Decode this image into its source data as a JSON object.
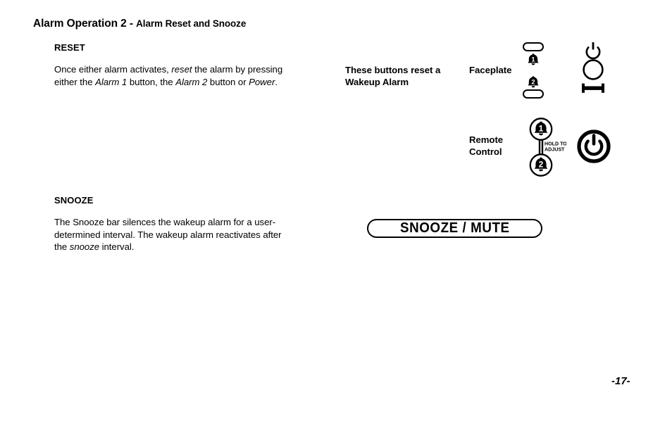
{
  "header": {
    "main": "Alarm Operation 2",
    "separator": " - ",
    "sub": "Alarm Reset and Snooze"
  },
  "sections": {
    "reset": {
      "title": "RESET",
      "body_html": "Once either alarm activates, <i>reset</i> the alarm by pressing either the <i>Alarm 1</i> button, the <i>Alarm 2</i> button or <i>Power</i>.",
      "body_text": "Once either alarm activates, reset the alarm by pressing either the Alarm 1 button, the Alarm 2 button or Power."
    },
    "snooze": {
      "title": "SNOOZE",
      "body_html": "The Snooze bar silences the wakeup alarm for a user-determined interval. The wakeup alarm reactivates after the <i>snooze</i> interval.",
      "body_text": "The Snooze bar silences the wakeup alarm for a user-determined interval. The wakeup alarm reactivates after the snooze interval."
    }
  },
  "diagram": {
    "reset_caption": "These buttons reset a Wakeup Alarm",
    "faceplate_label": "Faceplate",
    "remote_label": "Remote Control",
    "hold_to_adjust": {
      "line1": "HOLD TO",
      "line2": "ADJUST"
    },
    "icons": {
      "faceplate_alarm1": "bell-1-icon",
      "faceplate_alarm2": "bell-2-icon",
      "faceplate_button_top": "rounded-button-icon",
      "faceplate_button_bottom": "rounded-button-icon",
      "faceplate_power": "power-symbol-icon",
      "faceplate_knob": "round-knob-icon",
      "faceplate_bar": "bar-control-icon",
      "remote_alarm1": "round-bell-1-button-icon",
      "remote_alarm2": "round-bell-2-button-icon",
      "remote_power": "round-power-button-icon"
    },
    "bell_numbers": {
      "one": "1",
      "two": "2"
    }
  },
  "snooze_bar": {
    "label": "SNOOZE / MUTE"
  },
  "footer": {
    "page_number": "-17-"
  },
  "colors": {
    "ink": "#000000",
    "page": "#ffffff"
  }
}
